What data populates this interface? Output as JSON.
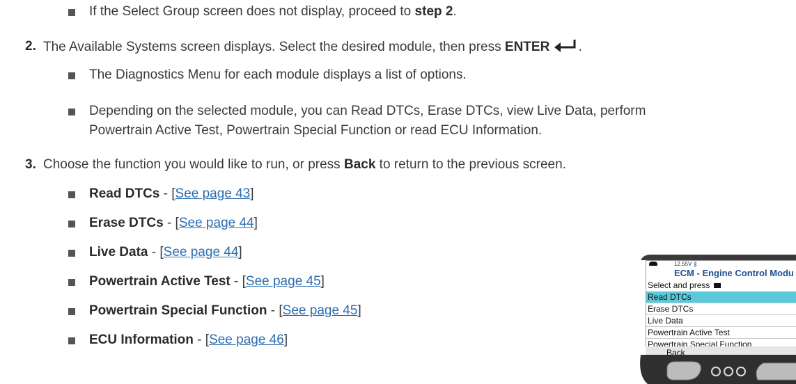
{
  "intro_bullet": {
    "text": "If the Select Group screen does not display, proceed to ",
    "bold": "step 2",
    "end": "."
  },
  "step2": {
    "num": "2.",
    "text": "The Available Systems screen displays. Select the desired module, then press ",
    "bold": "ENTER",
    "end": ".",
    "bullets": [
      "The Diagnostics Menu for each module displays a list of options.",
      "Depending on the selected module, you can Read DTCs, Erase DTCs, view Live Data, perform",
      "Powertrain Active Test, Powertrain Special Function or read ECU Information."
    ]
  },
  "step3": {
    "num": "3.",
    "text_a": "Choose the function you would like to run, or press ",
    "bold": "Back",
    "text_b": " to return to the previous screen.",
    "items": [
      {
        "label": "Read DTCs",
        "sep": " - [",
        "link": "See page 43",
        "close": "]"
      },
      {
        "label": "Erase DTCs",
        "sep": " - [",
        "link": "See page 44",
        "close": "]"
      },
      {
        "label": "Live Data",
        "sep": " - [",
        "link": "See page 44",
        "close": "]"
      },
      {
        "label": "Powertrain Active Test",
        "sep": " - [",
        "link": "See page 45",
        "close": "]"
      },
      {
        "label": "Powertrain Special Function",
        "sep": " - [",
        "link": "See page 45",
        "close": "]"
      },
      {
        "label": "ECU Information",
        "sep": " - [",
        "link": "See page 46",
        "close": "]"
      }
    ]
  },
  "device": {
    "voltage": "12.55V",
    "title": "ECM - Engine Control Modu",
    "prompt": "Select and press",
    "menu": [
      "Read DTCs",
      "Erase DTCs",
      "Live Data",
      "Powertrain Active Test",
      "Powertrain Special Function"
    ],
    "selected_color": "#5bc9db",
    "back": "Back"
  }
}
